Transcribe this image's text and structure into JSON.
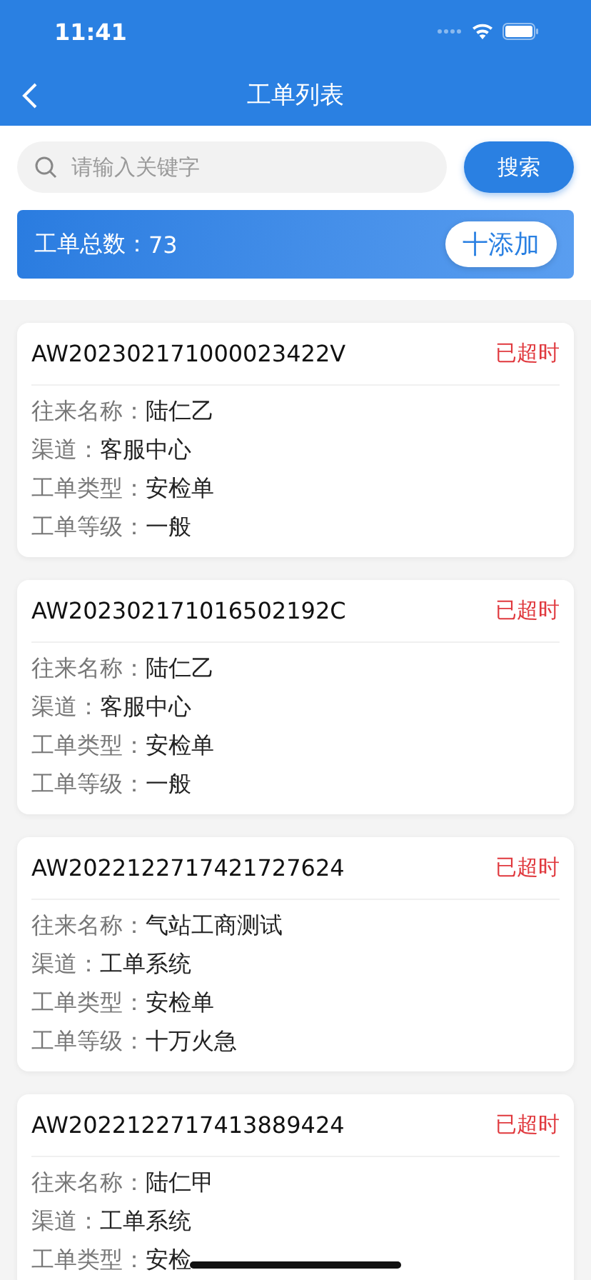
{
  "status_bar": {
    "time": "11:41"
  },
  "nav": {
    "title": "工单列表"
  },
  "search": {
    "placeholder": "请输入关键字",
    "button": "搜索"
  },
  "summary": {
    "label": "工单总数：",
    "count": "73",
    "add_button": "十添加"
  },
  "orders": [
    {
      "id": "AW202302171000023422V",
      "status": "已超时",
      "fields": [
        {
          "label": "往来名称：",
          "value": "陆仁乙"
        },
        {
          "label": "渠道：",
          "value": "客服中心"
        },
        {
          "label": "工单类型：",
          "value": "安检单"
        },
        {
          "label": "工单等级：",
          "value": "一般"
        }
      ]
    },
    {
      "id": "AW202302171016502192C",
      "status": "已超时",
      "fields": [
        {
          "label": "往来名称：",
          "value": "陆仁乙"
        },
        {
          "label": "渠道：",
          "value": "客服中心"
        },
        {
          "label": "工单类型：",
          "value": "安检单"
        },
        {
          "label": "工单等级：",
          "value": "一般"
        }
      ]
    },
    {
      "id": "AW2022122717421727624",
      "status": "已超时",
      "fields": [
        {
          "label": "往来名称：",
          "value": "气站工商测试"
        },
        {
          "label": "渠道：",
          "value": "工单系统"
        },
        {
          "label": "工单类型：",
          "value": "安检单"
        },
        {
          "label": "工单等级：",
          "value": "十万火急"
        }
      ]
    },
    {
      "id": "AW2022122717413889424",
      "status": "已超时",
      "fields": [
        {
          "label": "往来名称：",
          "value": "陆仁甲"
        },
        {
          "label": "渠道：",
          "value": "工单系统"
        },
        {
          "label": "工单类型：",
          "value": "安检"
        }
      ]
    }
  ]
}
